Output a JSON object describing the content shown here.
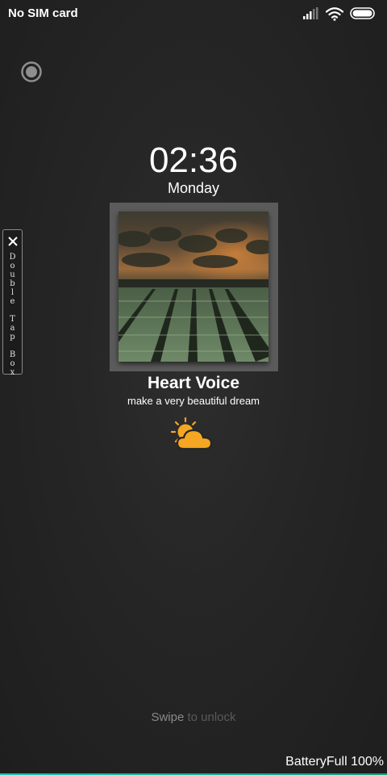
{
  "status_bar": {
    "carrier": "No SIM card",
    "icons": [
      "signal-icon",
      "wifi-icon",
      "battery-icon"
    ]
  },
  "lockscreen": {
    "time": "02:36",
    "weekday": "Monday",
    "record_icon": "record-icon"
  },
  "music": {
    "title": "Heart Voice",
    "subtitle": "make a very beautiful dream",
    "artwork": "tea-field-album-art"
  },
  "weather": {
    "icon": "partly-sunny-icon",
    "color": "#f5a623"
  },
  "double_tap_box": {
    "close_icon": "close-icon",
    "letters": [
      "D",
      "o",
      "u",
      "b",
      "l",
      "e",
      " ",
      "T",
      "a",
      "p",
      " ",
      "B",
      "o",
      "x"
    ]
  },
  "swipe_hint": {
    "part1": "Swipe",
    "part2": " to unlock"
  },
  "battery_text": "BatteryFull 100%",
  "colors": {
    "accent_line": "#17c3b0",
    "background": "#262626",
    "weather_orange": "#f5a623"
  }
}
